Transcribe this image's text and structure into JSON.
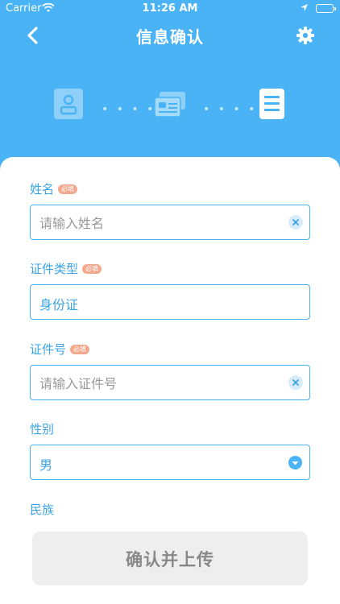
{
  "status_bar": {
    "carrier": "Carrier",
    "time": "11:26 AM"
  },
  "header": {
    "title": "信息确认",
    "back_icon": "chevron-left-icon",
    "settings_icon": "gear-icon"
  },
  "steps": {
    "icons": [
      "person-id-icon",
      "id-cards-icon",
      "document-list-icon"
    ],
    "separator": "• • • • •"
  },
  "form": {
    "required_badge": "必填",
    "name": {
      "label": "姓名",
      "required": true,
      "placeholder": "请输入姓名",
      "value": ""
    },
    "id_type": {
      "label": "证件类型",
      "required": true,
      "value": "身份证"
    },
    "id_number": {
      "label": "证件号",
      "required": true,
      "placeholder": "请输入证件号",
      "value": ""
    },
    "gender": {
      "label": "性别",
      "required": false,
      "value": "男"
    },
    "ethnicity": {
      "label": "民族",
      "required": false
    }
  },
  "submit": {
    "label": "确认并上传"
  },
  "colors": {
    "primary": "#49b3f5",
    "label_blue": "#3aa4e6",
    "badge": "#f3a78d",
    "disabled_button": "#eeeeee"
  }
}
